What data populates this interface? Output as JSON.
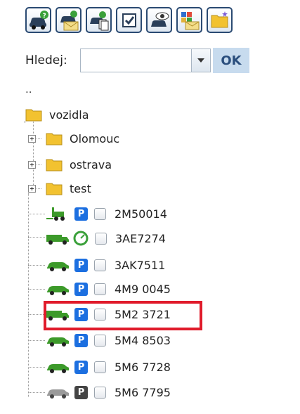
{
  "search": {
    "label": "Hledej:",
    "value": "",
    "ok_label": "OK"
  },
  "updir": "..",
  "root": {
    "label": "vozidla"
  },
  "folders": [
    {
      "label": "Olomouc"
    },
    {
      "label": "ostrava"
    },
    {
      "label": "test"
    }
  ],
  "vehicles": [
    {
      "plate": "2M50014",
      "icon": "forklift-icon",
      "status": "P",
      "status_color": "#1c6fe0",
      "selected": false
    },
    {
      "plate": "3AE7274",
      "icon": "truck-icon",
      "status": "gauge",
      "status_color": "#3aa03a",
      "selected": false
    },
    {
      "plate": "3AK7511",
      "icon": "car-icon",
      "status": "P",
      "status_color": "#1c6fe0",
      "selected": false
    },
    {
      "plate": "4M9 0045",
      "icon": "car-icon",
      "status": "P",
      "status_color": "#1c6fe0",
      "selected": false
    },
    {
      "plate": "5M2 3721",
      "icon": "truck-icon",
      "status": "P",
      "status_color": "#1c6fe0",
      "selected": false,
      "highlighted": true
    },
    {
      "plate": "5M4 8503",
      "icon": "car-icon",
      "status": "P",
      "status_color": "#1c6fe0",
      "selected": false
    },
    {
      "plate": "5M6 7728",
      "icon": "car-icon",
      "status": "P",
      "status_color": "#1c6fe0",
      "selected": false
    },
    {
      "plate": "5M6 7795",
      "icon": "car-gray-icon",
      "status": "P",
      "status_color": "#444444",
      "selected": false
    }
  ],
  "colors": {
    "vehicle_green": "#3c9a2a",
    "ok_bg": "#c7dbee",
    "highlight": "#e01b2b",
    "folder": "#f2c230"
  }
}
